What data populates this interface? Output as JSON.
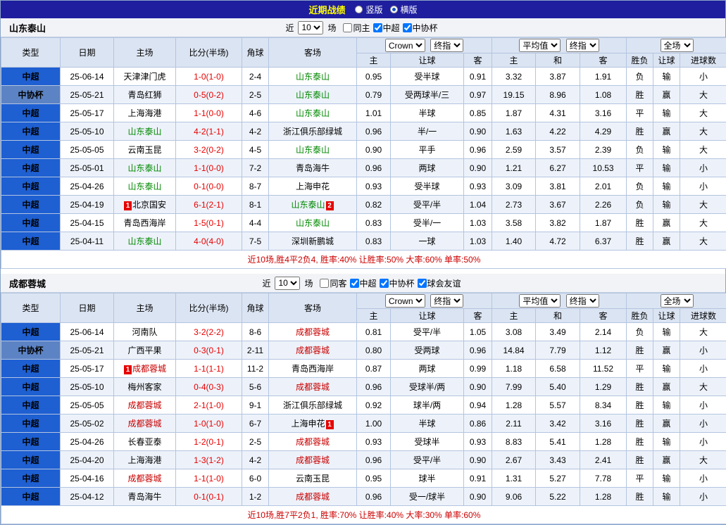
{
  "title_bar": {
    "title": "近期战绩",
    "radios": [
      {
        "label": "竖版",
        "selected": false
      },
      {
        "label": "横版",
        "selected": true
      }
    ]
  },
  "controls": {
    "near_label": "近",
    "games_value": "10",
    "games_label": "场",
    "bookmaker_select": "Crown",
    "asian_final_select": "终指",
    "average_select": "平均值",
    "euro_final_select": "终指",
    "scope_select": "全场"
  },
  "columns": {
    "type": "类型",
    "date": "日期",
    "home": "主场",
    "score": "比分(半场)",
    "corner": "角球",
    "away": "客场",
    "asian_home": "主",
    "asian_handicap": "让球",
    "asian_away": "客",
    "euro_home": "主",
    "euro_draw": "和",
    "euro_away": "客",
    "result_outcome": "胜负",
    "result_handicap": "让球",
    "result_goals": "进球数"
  },
  "colors": {
    "win_red": "#e60000",
    "draw_green": "#008800",
    "lose_black": "#111111",
    "under_blue": "#0000cc",
    "team_green": "#008800",
    "team_red": "#c80000",
    "league_csl_blue": "#1e5fd2",
    "league_cup_blue": "#5c83c4",
    "titlebar_blue": "#1e1e9e",
    "title_yellow": "#ffff00"
  },
  "sections": [
    {
      "team": "山东泰山",
      "filters": [
        {
          "label": "同主",
          "checked": false
        },
        {
          "label": "中超",
          "checked": true
        },
        {
          "label": "中协杯",
          "checked": true
        }
      ],
      "rows": [
        {
          "type": "中超",
          "league": "csl",
          "date": "25-06-14",
          "home": {
            "name": "天津津门虎",
            "color": "black"
          },
          "score": "1-0(1-0)",
          "corners": "2-4",
          "away": {
            "name": "山东泰山",
            "color": "green"
          },
          "asian": [
            "0.95",
            "受半球",
            "0.91"
          ],
          "euro": [
            "3.32",
            "3.87",
            "1.91"
          ],
          "results": [
            [
              "负",
              "black"
            ],
            [
              "输",
              "blue"
            ],
            [
              "小",
              "blue"
            ]
          ]
        },
        {
          "type": "中协杯",
          "league": "cup",
          "date": "25-05-21",
          "home": {
            "name": "青岛红狮",
            "color": "black"
          },
          "score": "0-5(0-2)",
          "corners": "2-5",
          "away": {
            "name": "山东泰山",
            "color": "green"
          },
          "asian": [
            "0.79",
            "受两球半/三",
            "0.97"
          ],
          "euro": [
            "19.15",
            "8.96",
            "1.08"
          ],
          "results": [
            [
              "胜",
              "red"
            ],
            [
              "赢",
              "red"
            ],
            [
              "大",
              "red"
            ]
          ]
        },
        {
          "type": "中超",
          "league": "csl",
          "date": "25-05-17",
          "home": {
            "name": "上海海港",
            "color": "black"
          },
          "score": "1-1(0-0)",
          "corners": "4-6",
          "away": {
            "name": "山东泰山",
            "color": "green"
          },
          "asian": [
            "1.01",
            "半球",
            "0.85"
          ],
          "euro": [
            "1.87",
            "4.31",
            "3.16"
          ],
          "results": [
            [
              "平",
              "green"
            ],
            [
              "输",
              "blue"
            ],
            [
              "大",
              "red"
            ]
          ]
        },
        {
          "type": "中超",
          "league": "csl",
          "date": "25-05-10",
          "home": {
            "name": "山东泰山",
            "color": "green"
          },
          "score": "4-2(1-1)",
          "corners": "4-2",
          "away": {
            "name": "浙江俱乐部绿城",
            "color": "black"
          },
          "asian": [
            "0.96",
            "半/一",
            "0.90"
          ],
          "euro": [
            "1.63",
            "4.22",
            "4.29"
          ],
          "results": [
            [
              "胜",
              "red"
            ],
            [
              "赢",
              "red"
            ],
            [
              "大",
              "red"
            ]
          ]
        },
        {
          "type": "中超",
          "league": "csl",
          "date": "25-05-05",
          "home": {
            "name": "云南玉昆",
            "color": "black"
          },
          "score": "3-2(0-2)",
          "corners": "4-5",
          "away": {
            "name": "山东泰山",
            "color": "green"
          },
          "asian": [
            "0.90",
            "平手",
            "0.96"
          ],
          "euro": [
            "2.59",
            "3.57",
            "2.39"
          ],
          "results": [
            [
              "负",
              "black"
            ],
            [
              "输",
              "blue"
            ],
            [
              "大",
              "red"
            ]
          ]
        },
        {
          "type": "中超",
          "league": "csl",
          "date": "25-05-01",
          "home": {
            "name": "山东泰山",
            "color": "green"
          },
          "score": "1-1(0-0)",
          "corners": "7-2",
          "away": {
            "name": "青岛海牛",
            "color": "black"
          },
          "asian": [
            "0.96",
            "两球",
            "0.90"
          ],
          "euro": [
            "1.21",
            "6.27",
            "10.53"
          ],
          "results": [
            [
              "平",
              "green"
            ],
            [
              "输",
              "blue"
            ],
            [
              "小",
              "blue"
            ]
          ]
        },
        {
          "type": "中超",
          "league": "csl",
          "date": "25-04-26",
          "home": {
            "name": "山东泰山",
            "color": "green"
          },
          "score": "0-1(0-0)",
          "corners": "8-7",
          "away": {
            "name": "上海申花",
            "color": "black"
          },
          "asian": [
            "0.93",
            "受半球",
            "0.93"
          ],
          "euro": [
            "3.09",
            "3.81",
            "2.01"
          ],
          "results": [
            [
              "负",
              "black"
            ],
            [
              "输",
              "blue"
            ],
            [
              "小",
              "blue"
            ]
          ]
        },
        {
          "type": "中超",
          "league": "csl",
          "date": "25-04-19",
          "home": {
            "name": "北京国安",
            "color": "black",
            "card": "1",
            "card_pos": "before"
          },
          "score": "6-1(2-1)",
          "corners": "8-1",
          "away": {
            "name": "山东泰山",
            "color": "green",
            "card": "2",
            "card_pos": "after"
          },
          "asian": [
            "0.82",
            "受平/半",
            "1.04"
          ],
          "euro": [
            "2.73",
            "3.67",
            "2.26"
          ],
          "results": [
            [
              "负",
              "black"
            ],
            [
              "输",
              "blue"
            ],
            [
              "大",
              "red"
            ]
          ]
        },
        {
          "type": "中超",
          "league": "csl",
          "date": "25-04-15",
          "home": {
            "name": "青岛西海岸",
            "color": "black"
          },
          "score": "1-5(0-1)",
          "corners": "4-4",
          "away": {
            "name": "山东泰山",
            "color": "green"
          },
          "asian": [
            "0.83",
            "受半/一",
            "1.03"
          ],
          "euro": [
            "3.58",
            "3.82",
            "1.87"
          ],
          "results": [
            [
              "胜",
              "red"
            ],
            [
              "赢",
              "red"
            ],
            [
              "大",
              "red"
            ]
          ]
        },
        {
          "type": "中超",
          "league": "csl",
          "date": "25-04-11",
          "home": {
            "name": "山东泰山",
            "color": "green"
          },
          "score": "4-0(4-0)",
          "corners": "7-5",
          "away": {
            "name": "深圳新鹏城",
            "color": "black"
          },
          "asian": [
            "0.83",
            "一球",
            "1.03"
          ],
          "euro": [
            "1.40",
            "4.72",
            "6.37"
          ],
          "results": [
            [
              "胜",
              "red"
            ],
            [
              "赢",
              "red"
            ],
            [
              "大",
              "red"
            ]
          ]
        }
      ],
      "summary": "近10场,胜4平2负4, 胜率:40% 让胜率:50% 大率:60% 单率:50%"
    },
    {
      "team": "成都蓉城",
      "filters": [
        {
          "label": "同客",
          "checked": false
        },
        {
          "label": "中超",
          "checked": true
        },
        {
          "label": "中协杯",
          "checked": true
        },
        {
          "label": "球会友谊",
          "checked": true
        }
      ],
      "rows": [
        {
          "type": "中超",
          "league": "csl",
          "date": "25-06-14",
          "home": {
            "name": "河南队",
            "color": "black"
          },
          "score": "3-2(2-2)",
          "corners": "8-6",
          "away": {
            "name": "成都蓉城",
            "color": "red"
          },
          "asian": [
            "0.81",
            "受平/半",
            "1.05"
          ],
          "euro": [
            "3.08",
            "3.49",
            "2.14"
          ],
          "results": [
            [
              "负",
              "black"
            ],
            [
              "输",
              "blue"
            ],
            [
              "大",
              "red"
            ]
          ]
        },
        {
          "type": "中协杯",
          "league": "cup",
          "date": "25-05-21",
          "home": {
            "name": "广西平果",
            "color": "black"
          },
          "score": "0-3(0-1)",
          "corners": "2-11",
          "away": {
            "name": "成都蓉城",
            "color": "red"
          },
          "asian": [
            "0.80",
            "受两球",
            "0.96"
          ],
          "euro": [
            "14.84",
            "7.79",
            "1.12"
          ],
          "results": [
            [
              "胜",
              "red"
            ],
            [
              "赢",
              "red"
            ],
            [
              "小",
              "blue"
            ]
          ]
        },
        {
          "type": "中超",
          "league": "csl",
          "date": "25-05-17",
          "home": {
            "name": "成都蓉城",
            "color": "red",
            "card": "1",
            "card_pos": "before"
          },
          "score": "1-1(1-1)",
          "corners": "11-2",
          "away": {
            "name": "青岛西海岸",
            "color": "black"
          },
          "asian": [
            "0.87",
            "两球",
            "0.99"
          ],
          "euro": [
            "1.18",
            "6.58",
            "11.52"
          ],
          "results": [
            [
              "平",
              "green"
            ],
            [
              "输",
              "blue"
            ],
            [
              "小",
              "blue"
            ]
          ]
        },
        {
          "type": "中超",
          "league": "csl",
          "date": "25-05-10",
          "home": {
            "name": "梅州客家",
            "color": "black"
          },
          "score": "0-4(0-3)",
          "corners": "5-6",
          "away": {
            "name": "成都蓉城",
            "color": "red"
          },
          "asian": [
            "0.96",
            "受球半/两",
            "0.90"
          ],
          "euro": [
            "7.99",
            "5.40",
            "1.29"
          ],
          "results": [
            [
              "胜",
              "red"
            ],
            [
              "赢",
              "red"
            ],
            [
              "大",
              "red"
            ]
          ]
        },
        {
          "type": "中超",
          "league": "csl",
          "date": "25-05-05",
          "home": {
            "name": "成都蓉城",
            "color": "red"
          },
          "score": "2-1(1-0)",
          "corners": "9-1",
          "away": {
            "name": "浙江俱乐部绿城",
            "color": "black"
          },
          "asian": [
            "0.92",
            "球半/两",
            "0.94"
          ],
          "euro": [
            "1.28",
            "5.57",
            "8.34"
          ],
          "results": [
            [
              "胜",
              "red"
            ],
            [
              "输",
              "blue"
            ],
            [
              "小",
              "blue"
            ]
          ]
        },
        {
          "type": "中超",
          "league": "csl",
          "date": "25-05-02",
          "home": {
            "name": "成都蓉城",
            "color": "red"
          },
          "score": "1-0(1-0)",
          "corners": "6-7",
          "away": {
            "name": "上海申花",
            "color": "black",
            "card": "1",
            "card_pos": "after"
          },
          "asian": [
            "1.00",
            "半球",
            "0.86"
          ],
          "euro": [
            "2.11",
            "3.42",
            "3.16"
          ],
          "results": [
            [
              "胜",
              "red"
            ],
            [
              "赢",
              "red"
            ],
            [
              "小",
              "blue"
            ]
          ]
        },
        {
          "type": "中超",
          "league": "csl",
          "date": "25-04-26",
          "home": {
            "name": "长春亚泰",
            "color": "black"
          },
          "score": "1-2(0-1)",
          "corners": "2-5",
          "away": {
            "name": "成都蓉城",
            "color": "red"
          },
          "asian": [
            "0.93",
            "受球半",
            "0.93"
          ],
          "euro": [
            "8.83",
            "5.41",
            "1.28"
          ],
          "results": [
            [
              "胜",
              "red"
            ],
            [
              "输",
              "blue"
            ],
            [
              "小",
              "blue"
            ]
          ]
        },
        {
          "type": "中超",
          "league": "csl",
          "date": "25-04-20",
          "home": {
            "name": "上海海港",
            "color": "black"
          },
          "score": "1-3(1-2)",
          "corners": "4-2",
          "away": {
            "name": "成都蓉城",
            "color": "red"
          },
          "asian": [
            "0.96",
            "受平/半",
            "0.90"
          ],
          "euro": [
            "2.67",
            "3.43",
            "2.41"
          ],
          "results": [
            [
              "胜",
              "red"
            ],
            [
              "赢",
              "red"
            ],
            [
              "大",
              "red"
            ]
          ]
        },
        {
          "type": "中超",
          "league": "csl",
          "date": "25-04-16",
          "home": {
            "name": "成都蓉城",
            "color": "red"
          },
          "score": "1-1(1-0)",
          "corners": "6-0",
          "away": {
            "name": "云南玉昆",
            "color": "black"
          },
          "asian": [
            "0.95",
            "球半",
            "0.91"
          ],
          "euro": [
            "1.31",
            "5.27",
            "7.78"
          ],
          "results": [
            [
              "平",
              "green"
            ],
            [
              "输",
              "blue"
            ],
            [
              "小",
              "blue"
            ]
          ]
        },
        {
          "type": "中超",
          "league": "csl",
          "date": "25-04-12",
          "home": {
            "name": "青岛海牛",
            "color": "black"
          },
          "score": "0-1(0-1)",
          "corners": "1-2",
          "away": {
            "name": "成都蓉城",
            "color": "red"
          },
          "asian": [
            "0.96",
            "受一/球半",
            "0.90"
          ],
          "euro": [
            "9.06",
            "5.22",
            "1.28"
          ],
          "results": [
            [
              "胜",
              "red"
            ],
            [
              "输",
              "blue"
            ],
            [
              "小",
              "blue"
            ]
          ]
        }
      ],
      "summary": "近10场,胜7平2负1, 胜率:70% 让胜率:40% 大率:30% 单率:60%"
    }
  ]
}
